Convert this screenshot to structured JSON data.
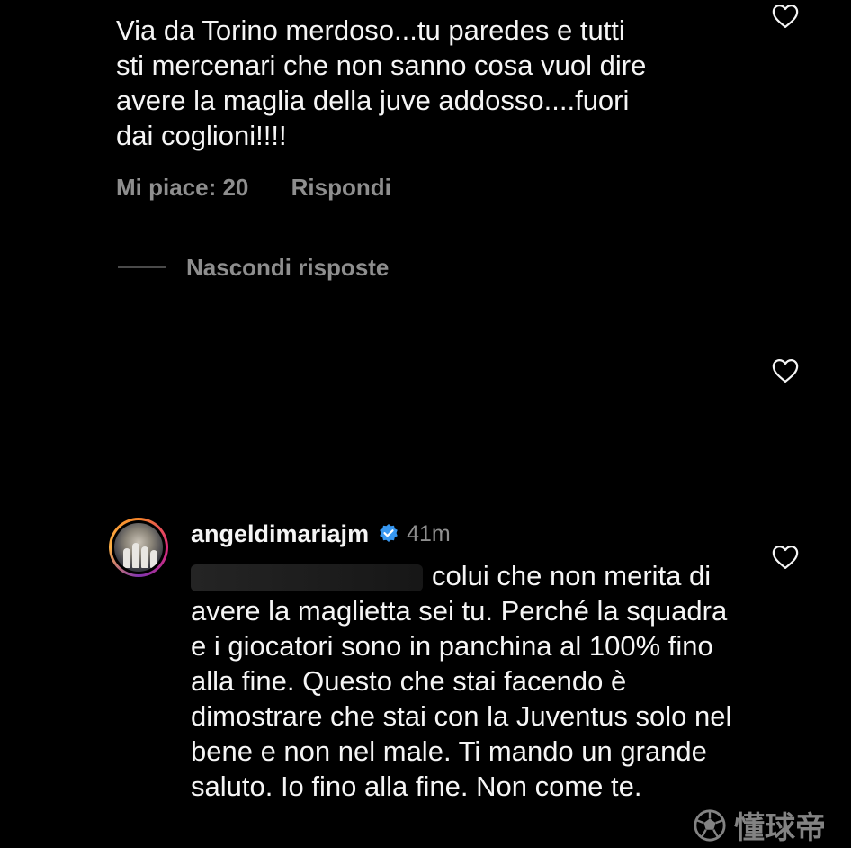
{
  "comment": {
    "text": "Via da Torino merdoso...tu paredes e tutti\nsti mercenari che non sanno cosa vuol dire\navere la maglia della juve addosso....fuori\ndai coglioni!!!!",
    "likes_label": "Mi piace: 20",
    "reply_label": "Rispondi"
  },
  "replies_toggle": {
    "label": "Nascondi risposte"
  },
  "reply": {
    "username": "angeldimariajm",
    "time": "41m",
    "text": "colui che non merita di avere la maglietta sei tu. Perché la squadra e i giocatori sono in panchina al 100% fino alla fine. Questo che stai facendo è dimostrare che stai con la Juventus solo nel bene e non nel male. Ti mando un grande saluto. Io fino alla fine. Non come te."
  },
  "watermark": {
    "text": "懂球帝"
  },
  "icons": {
    "like": "heart-outline-icon",
    "verified": "verified-badge-icon",
    "watermark_logo": "soccer-ball-icon"
  },
  "colors": {
    "background": "#000000",
    "text_primary": "#f5f5f5",
    "text_secondary": "#8e8e8e",
    "verified_blue": "#3797f0"
  }
}
